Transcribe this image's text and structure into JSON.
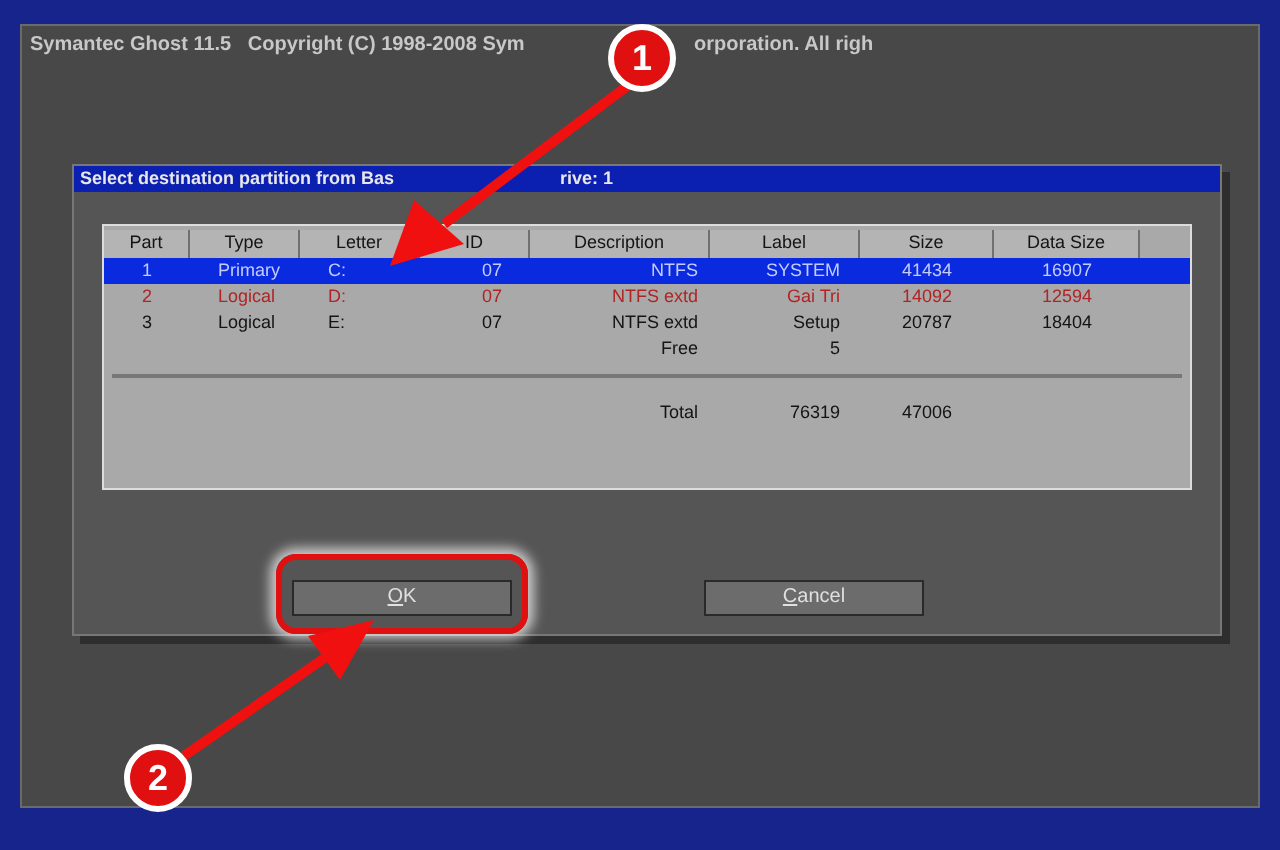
{
  "window": {
    "title_parts": [
      "Symantec Ghost 11.5   Copyright (C) 1998-2008 Sym",
      "orporation. All righ"
    ]
  },
  "dialog": {
    "title_parts": [
      "Select destination partition from Bas",
      "rive: 1"
    ],
    "columns": [
      "Part",
      "Type",
      "Letter",
      "ID",
      "Description",
      "Label",
      "Size",
      "Data Size"
    ],
    "rows": [
      {
        "selected": true,
        "kind": "normal",
        "part": "1",
        "type": "Primary",
        "letter": "C:",
        "id": "07",
        "description": "NTFS",
        "label": "SYSTEM",
        "size": "41434",
        "data_size": "16907"
      },
      {
        "selected": false,
        "kind": "source",
        "part": "2",
        "type": "Logical",
        "letter": "D:",
        "id": "07",
        "description": "NTFS extd",
        "label": "Gai Tri",
        "size": "14092",
        "data_size": "12594"
      },
      {
        "selected": false,
        "kind": "normal",
        "part": "3",
        "type": "Logical",
        "letter": "E:",
        "id": "07",
        "description": "NTFS extd",
        "label": "Setup",
        "size": "20787",
        "data_size": "18404"
      },
      {
        "selected": false,
        "kind": "normal",
        "description": "Free",
        "label": "5"
      }
    ],
    "total": {
      "description": "Total",
      "label": "76319",
      "size": "47006"
    },
    "buttons": [
      {
        "label": "OK",
        "highlighted": true
      },
      {
        "label": "Cancel",
        "highlighted": false
      }
    ]
  },
  "annotations": [
    {
      "number": "1"
    },
    {
      "number": "2"
    }
  ]
}
